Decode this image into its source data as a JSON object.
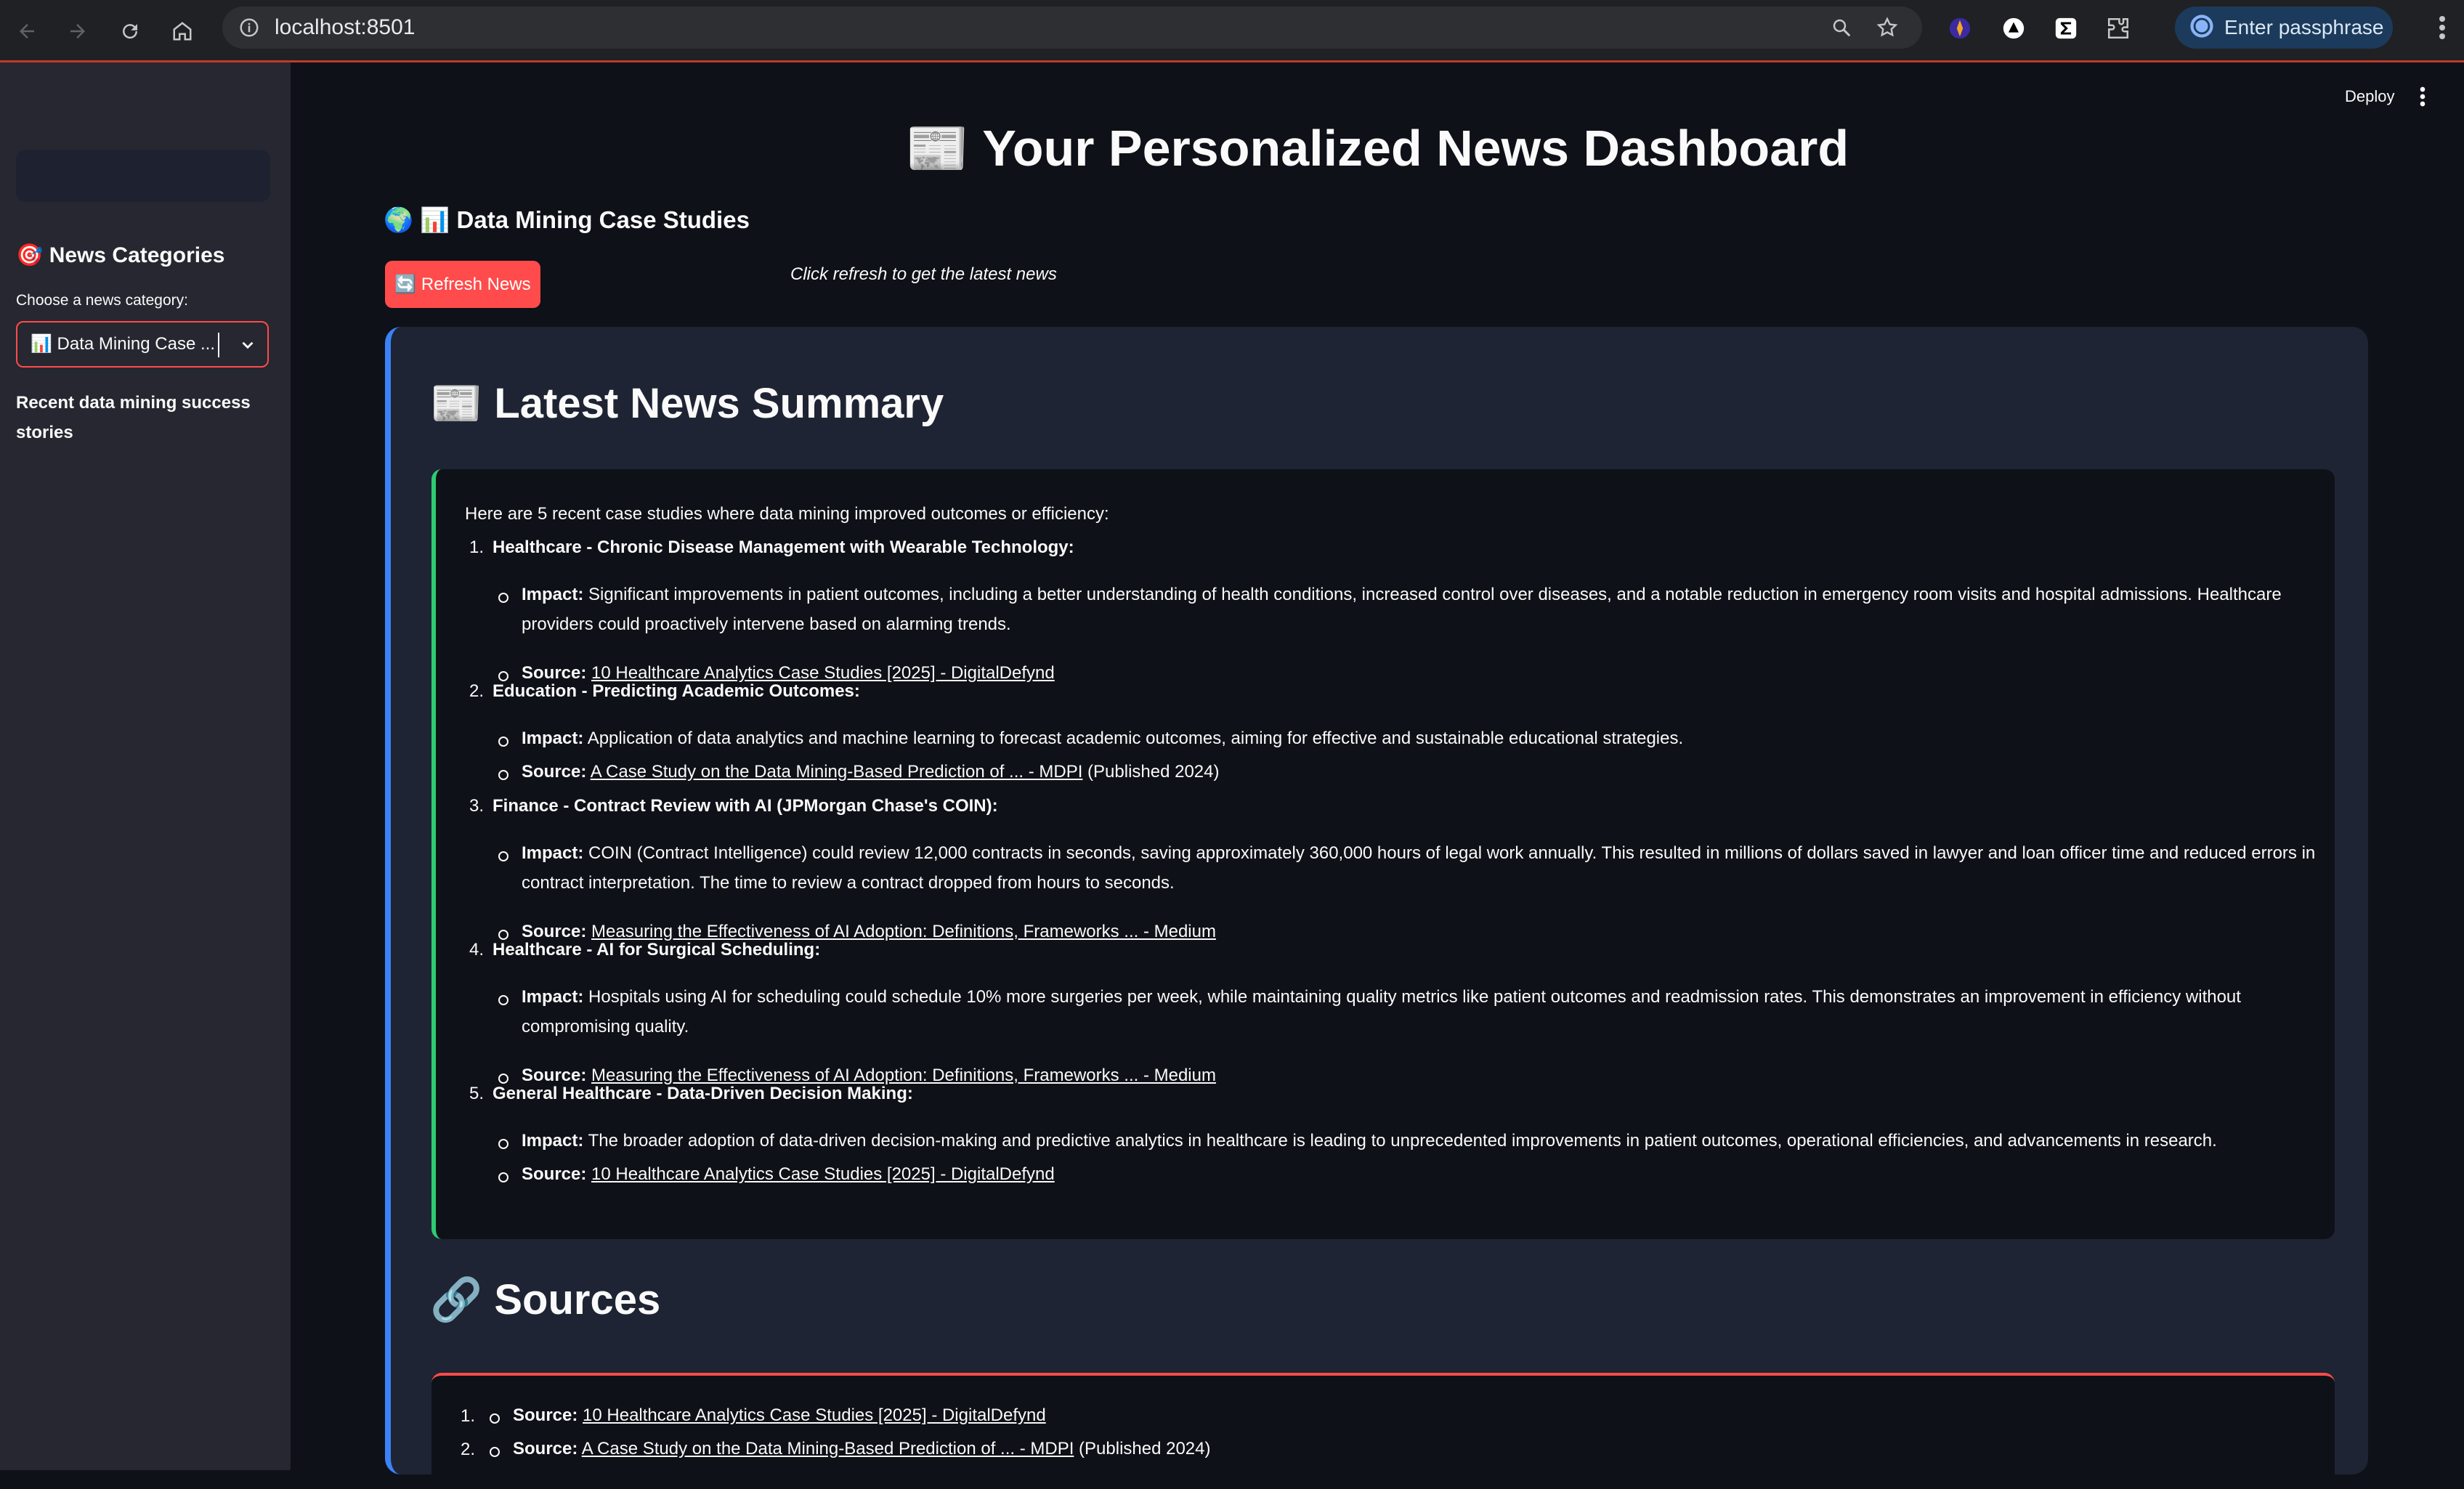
{
  "browser": {
    "url": "localhost:8501",
    "passphrase_label": "Enter passphrase"
  },
  "sidebar": {
    "heading": "News Categories",
    "select_label": "Choose a news category:",
    "select_value": "📊 Data Mining Case ...",
    "description": "Recent data mining success stories"
  },
  "header": {
    "deploy_label": "Deploy"
  },
  "main": {
    "title": "📰 Your Personalized News Dashboard",
    "subheading": "🌍 📊 Data Mining Case Studies",
    "refresh_label": "🔄 Refresh News",
    "hint": "Click refresh to get the latest news"
  },
  "summary": {
    "title": "📰 Latest News Summary",
    "intro": "Here are 5 recent case studies where data mining improved outcomes or efficiency:",
    "impact_label": "Impact:",
    "source_label": "Source:",
    "items": [
      {
        "num": "1.",
        "title": "Healthcare - Chronic Disease Management with Wearable Technology:",
        "impact_line1": "Significant improvements in patient outcomes, including a better understanding of health conditions, increased control over diseases, and a notable reduction in emergency room visits and hospital admissions. Healthcare",
        "impact_line2": "providers could proactively intervene based on alarming trends.",
        "source_link": "10 Healthcare Analytics Case Studies [2025] - DigitalDefynd",
        "source_extra": ""
      },
      {
        "num": "2.",
        "title": "Education - Predicting Academic Outcomes:",
        "impact_line1": "Application of data analytics and machine learning to forecast academic outcomes, aiming for effective and sustainable educational strategies.",
        "impact_line2": "",
        "source_link": "A Case Study on the Data Mining-Based Prediction of ... - MDPI",
        "source_extra": " (Published 2024)"
      },
      {
        "num": "3.",
        "title": "Finance - Contract Review with AI (JPMorgan Chase's COIN):",
        "impact_line1": "COIN (Contract Intelligence) could review 12,000 contracts in seconds, saving approximately 360,000 hours of legal work annually. This resulted in millions of dollars saved in lawyer and loan officer time and reduced errors in",
        "impact_line2": "contract interpretation. The time to review a contract dropped from hours to seconds.",
        "source_link": "Measuring the Effectiveness of AI Adoption: Definitions, Frameworks ... - Medium",
        "source_extra": ""
      },
      {
        "num": "4.",
        "title": "Healthcare - AI for Surgical Scheduling:",
        "impact_line1": "Hospitals using AI for scheduling could schedule 10% more surgeries per week, while maintaining quality metrics like patient outcomes and readmission rates. This demonstrates an improvement in efficiency without",
        "impact_line2": "compromising quality.",
        "source_link": "Measuring the Effectiveness of AI Adoption: Definitions, Frameworks ... - Medium",
        "source_extra": ""
      },
      {
        "num": "5.",
        "title": "General Healthcare - Data-Driven Decision Making:",
        "impact_line1": "The broader adoption of data-driven decision-making and predictive analytics in healthcare is leading to unprecedented improvements in patient outcomes, operational efficiencies, and advancements in research.",
        "impact_line2": "",
        "source_link": "10 Healthcare Analytics Case Studies [2025] - DigitalDefynd",
        "source_extra": ""
      }
    ]
  },
  "sources": {
    "title": "🔗 Sources",
    "items": [
      {
        "num": "1.",
        "label": "Source:",
        "link": "10 Healthcare Analytics Case Studies [2025] - DigitalDefynd",
        "extra": ""
      },
      {
        "num": "2.",
        "label": "Source:",
        "link": "A Case Study on the Data Mining-Based Prediction of ... - MDPI",
        "extra": " (Published 2024)"
      }
    ]
  }
}
